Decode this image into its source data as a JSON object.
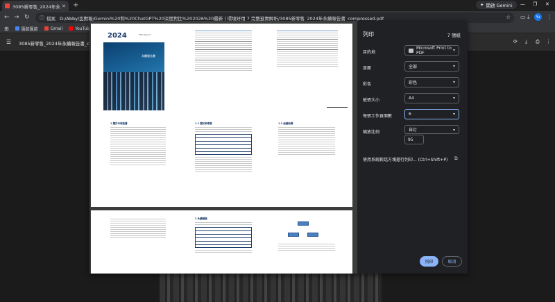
{
  "browser": {
    "tab_title": "3085新零售_2024年永續報告書",
    "new_tab_symbol": "+",
    "gemini_label": "開啟 Gemini",
    "omnibox_label": "檔案",
    "url": "D:/Abby/比對報/Gemini%20和%20ChatGPT%20深度對比%202026%20最新 | 環境好用 7 完整進實解析/3085新零售_2024年永續報告書_compressed.pdf"
  },
  "bookmarks": [
    {
      "label": "匯款匯款",
      "color": "#4285f4"
    },
    {
      "label": "Gmail",
      "color": "#ea4335"
    },
    {
      "label": "YouTube",
      "color": "#ff0000"
    }
  ],
  "viewer": {
    "file_name": "3085新零售_2024年永續報告書_compr"
  },
  "preview": {
    "cover_year": "2024",
    "cover_subtitle": "ESG Report",
    "cover_label": "永續報告書"
  },
  "print": {
    "title": "列印",
    "sheet_count": "7 張紙",
    "destination_label": "目的地",
    "destination_value": "Microsoft Print to PDF",
    "pages_label": "頁面",
    "pages_value": "全部",
    "color_label": "彩色",
    "color_value": "彩色",
    "paper_label": "紙張大小",
    "paper_value": "A4",
    "pages_per_sheet_label": "每張工作頁面數",
    "pages_per_sheet_value": "6",
    "scale_label": "縮放比例",
    "scale_value": "自訂",
    "scale_percent": "95",
    "system_dialog": "使用系統對話方塊進行列印... (Ctrl+Shift+P)",
    "print_button": "列印",
    "cancel_button": "取消"
  }
}
